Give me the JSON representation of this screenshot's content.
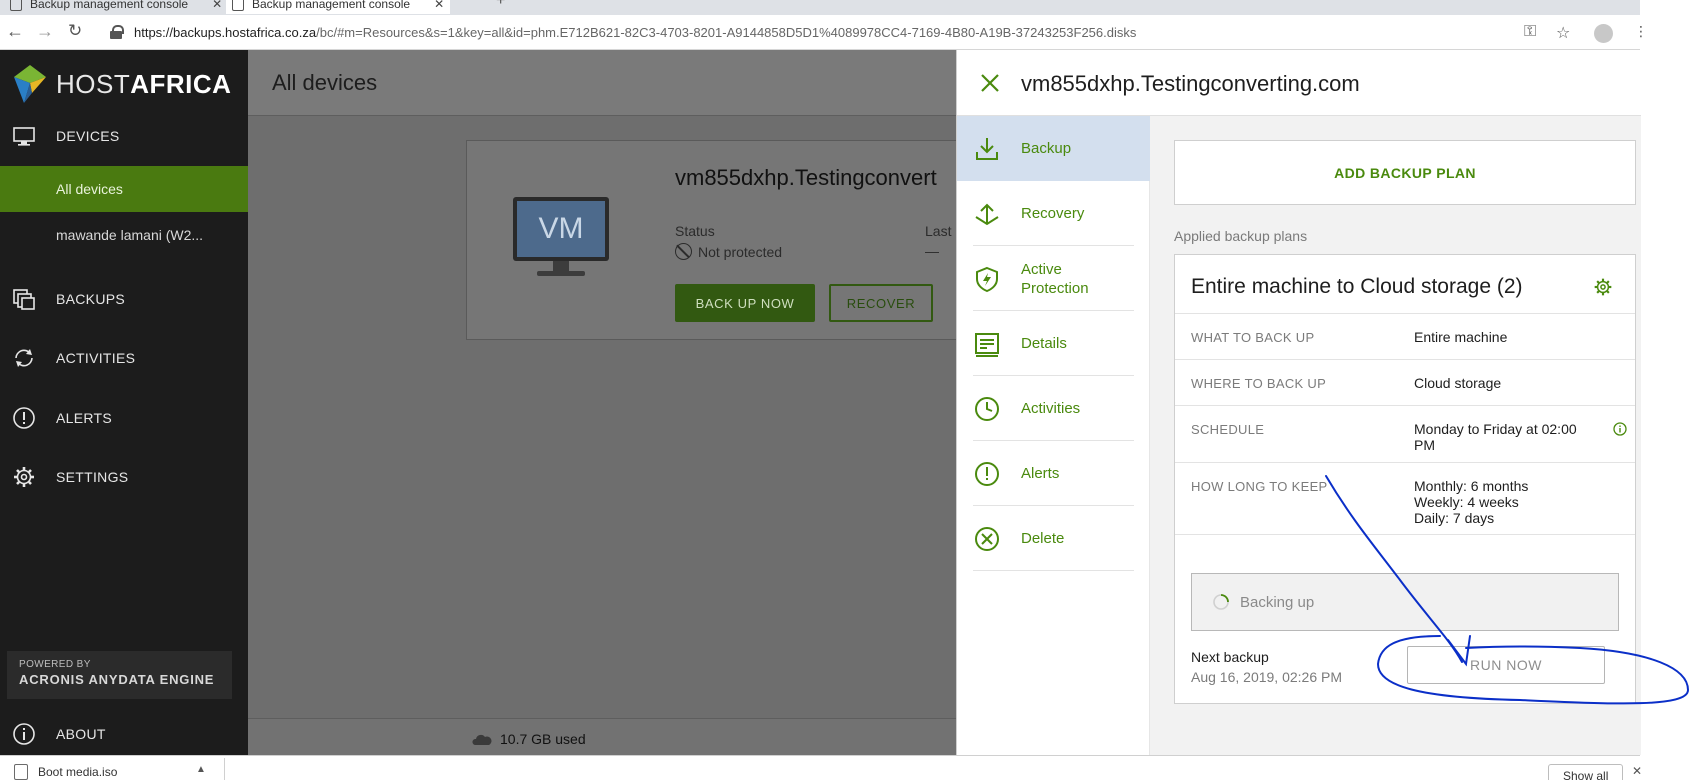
{
  "browser": {
    "tabs": [
      {
        "title": "Backup management console",
        "active": false
      },
      {
        "title": "Backup management console",
        "active": true
      }
    ],
    "new_tab_glyph": "+",
    "url_host": "https://backups.hostafrica.co.za",
    "url_rest": "/bc/#m=Resources&s=1&key=all&id=phm.E712B621-82C3-4703-8201-A9144858D5D1%4089978CC4-7169-4B80-A19B-37243253F256.disks",
    "icons": [
      "back-arrow-icon",
      "forward-arrow-icon",
      "reload-icon",
      "lock-icon",
      "key-icon",
      "star-icon",
      "profile-icon",
      "kebab-menu-icon"
    ]
  },
  "sidebar": {
    "logo_thin": "HOST",
    "logo_bold": "AFRICA",
    "nav": [
      {
        "label": "DEVICES",
        "icon": "monitor-icon"
      },
      {
        "label": "BACKUPS",
        "icon": "backups-stack-icon"
      },
      {
        "label": "ACTIVITIES",
        "icon": "activities-sync-icon"
      },
      {
        "label": "ALERTS",
        "icon": "alert-icon"
      },
      {
        "label": "SETTINGS",
        "icon": "gear-icon"
      },
      {
        "label": "ABOUT",
        "icon": "info-icon"
      }
    ],
    "sub_items": [
      {
        "label": "All devices",
        "selected": true
      },
      {
        "label": "mawande lamani (W2...",
        "selected": false
      }
    ],
    "powered_by": "POWERED BY",
    "engine": "ACRONIS ANYDATA ENGINE"
  },
  "main": {
    "title": "All devices",
    "card": {
      "icon_text": "VM",
      "device_name": "vm855dxhp.Testingconvert",
      "status_label": "Status",
      "status_value": "Not protected",
      "last_label": "Last",
      "last_value": "—",
      "back_up_now": "BACK UP NOW",
      "recover": "RECOVER"
    },
    "storage_used": "10.7 GB used"
  },
  "panel": {
    "title": "vm855dxhp.Testingconverting.com",
    "nav": [
      {
        "label": "Backup",
        "icon": "download-backup-icon",
        "selected": true
      },
      {
        "label": "Recovery",
        "icon": "upload-recovery-icon",
        "selected": false
      },
      {
        "label": "Active Protection",
        "icon": "shield-bolt-icon",
        "selected": false
      },
      {
        "label": "Details",
        "icon": "details-card-icon",
        "selected": false
      },
      {
        "label": "Activities",
        "icon": "clock-icon",
        "selected": false
      },
      {
        "label": "Alerts",
        "icon": "alert-circle-icon",
        "selected": false
      },
      {
        "label": "Delete",
        "icon": "delete-circle-x-icon",
        "selected": false
      }
    ],
    "add_backup_plan": "ADD BACKUP PLAN",
    "applied_label": "Applied backup plans",
    "plan": {
      "title": "Entire machine to Cloud storage (2)",
      "rows": [
        {
          "key": "WHAT TO BACK UP",
          "value": "Entire machine"
        },
        {
          "key": "WHERE TO BACK UP",
          "value": "Cloud storage"
        },
        {
          "key": "SCHEDULE",
          "value": "Monday to Friday at 02:00 PM"
        },
        {
          "key": "HOW LONG TO KEEP",
          "value_lines": [
            "Monthly: 6 months",
            "Weekly: 4 weeks",
            "Daily: 7 days"
          ]
        }
      ],
      "backing_up": "Backing up",
      "next_backup_label": "Next backup",
      "next_backup_value": "Aug 16, 2019, 02:26 PM",
      "run_now": "RUN NOW"
    }
  },
  "downloads": {
    "file": "Boot media.iso",
    "show_all": "Show all"
  },
  "colors": {
    "accent_green": "#4a8a0e",
    "sidebar_bg": "#1c1c1c",
    "selected_green": "#4a7a10",
    "selected_nav_blue": "#d3dfee",
    "annotation_blue": "#0b2fc8"
  }
}
